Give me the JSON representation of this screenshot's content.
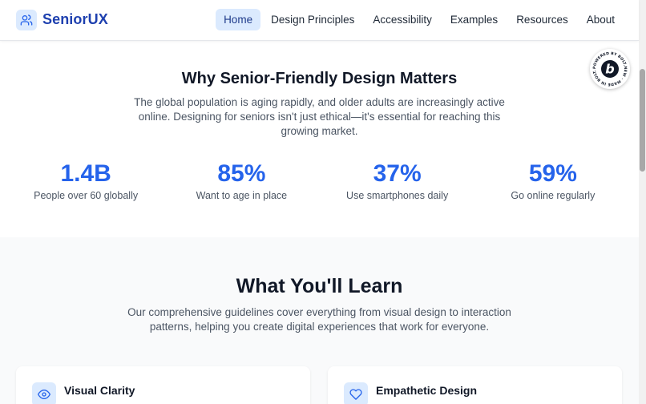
{
  "nav": {
    "logo_icon": "users-icon",
    "brand": "SeniorUX",
    "links": [
      {
        "label": "Home",
        "active": true
      },
      {
        "label": "Design Principles",
        "active": false
      },
      {
        "label": "Accessibility",
        "active": false
      },
      {
        "label": "Examples",
        "active": false
      },
      {
        "label": "Resources",
        "active": false
      },
      {
        "label": "About",
        "active": false
      }
    ]
  },
  "why": {
    "title": "Why Senior-Friendly Design Matters",
    "description": "The global population is aging rapidly, and older adults are increasingly active online. Designing for seniors isn't just ethical—it's essential for reaching this growing market.",
    "stats": [
      {
        "value": "1.4B",
        "label": "People over 60 globally"
      },
      {
        "value": "85%",
        "label": "Want to age in place"
      },
      {
        "value": "37%",
        "label": "Use smartphones daily"
      },
      {
        "value": "59%",
        "label": "Go online regularly"
      }
    ]
  },
  "learn": {
    "title": "What You'll Learn",
    "description": "Our comprehensive guidelines cover everything from visual design to interaction patterns, helping you create digital experiences that work for everyone.",
    "cards": [
      {
        "title": "Visual Clarity",
        "icon": "eye-icon"
      },
      {
        "title": "Empathetic Design",
        "icon": "heart-icon"
      }
    ]
  },
  "badge": {
    "ring_text": "POWERED BY BOLT.NEW · MADE IN BOLT.NEW ·",
    "letter": "b"
  },
  "colors": {
    "accent": "#2563eb",
    "brand": "#1e40af",
    "accent_light": "#dbeafe"
  }
}
